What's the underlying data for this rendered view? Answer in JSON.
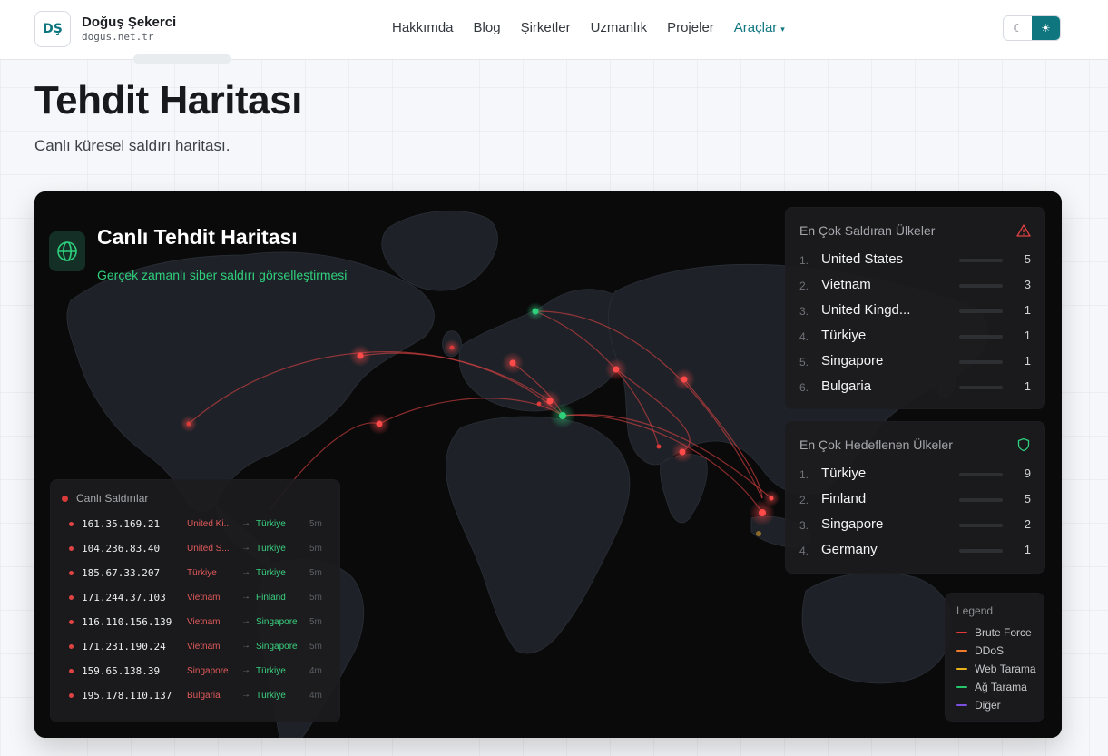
{
  "header": {
    "logo_text": "DŞ",
    "brand_name": "Doğuş Şekerci",
    "brand_url": "dogus.net.tr",
    "nav": [
      {
        "label": "Hakkımda"
      },
      {
        "label": "Blog"
      },
      {
        "label": "Şirketler"
      },
      {
        "label": "Uzmanlık"
      },
      {
        "label": "Projeler"
      },
      {
        "label": "Araçlar",
        "caret": "▾"
      }
    ],
    "theme": {
      "dark_icon": "☾",
      "light_icon": "☀",
      "active": "light"
    }
  },
  "page": {
    "title": "Tehdit Haritası",
    "subtitle": "Canlı küresel saldırı haritası."
  },
  "map": {
    "title": "Canlı Tehdit Haritası",
    "subtitle": "Gerçek zamanlı siber saldırı görselleştirmesi",
    "colors": {
      "attack": "#e04343",
      "target": "#2fcf7c",
      "accent": "#0f7680"
    }
  },
  "top_attackers": {
    "title": "En Çok Saldıran Ülkeler",
    "icon": "warning-triangle-icon",
    "items": [
      {
        "rank": "1.",
        "country": "United States",
        "count": "5"
      },
      {
        "rank": "2.",
        "country": "Vietnam",
        "count": "3"
      },
      {
        "rank": "3.",
        "country": "United Kingd...",
        "count": "1"
      },
      {
        "rank": "4.",
        "country": "Türkiye",
        "count": "1"
      },
      {
        "rank": "5.",
        "country": "Singapore",
        "count": "1"
      },
      {
        "rank": "6.",
        "country": "Bulgaria",
        "count": "1"
      }
    ]
  },
  "top_targets": {
    "title": "En Çok Hedeflenen Ülkeler",
    "icon": "shield-icon",
    "items": [
      {
        "rank": "1.",
        "country": "Türkiye",
        "count": "9"
      },
      {
        "rank": "2.",
        "country": "Finland",
        "count": "5"
      },
      {
        "rank": "3.",
        "country": "Singapore",
        "count": "2"
      },
      {
        "rank": "4.",
        "country": "Germany",
        "count": "1"
      }
    ]
  },
  "live_attacks": {
    "title": "Canlı Saldırılar",
    "rows": [
      {
        "ip": "161.35.169.21",
        "source": "United Ki...",
        "target": "Türkiye",
        "time": "5m"
      },
      {
        "ip": "104.236.83.40",
        "source": "United S...",
        "target": "Türkiye",
        "time": "5m"
      },
      {
        "ip": "185.67.33.207",
        "source": "Türkiye",
        "target": "Türkiye",
        "time": "5m"
      },
      {
        "ip": "171.244.37.103",
        "source": "Vietnam",
        "target": "Finland",
        "time": "5m"
      },
      {
        "ip": "116.110.156.139",
        "source": "Vietnam",
        "target": "Singapore",
        "time": "5m"
      },
      {
        "ip": "171.231.190.24",
        "source": "Vietnam",
        "target": "Singapore",
        "time": "5m"
      },
      {
        "ip": "159.65.138.39",
        "source": "Singapore",
        "target": "Türkiye",
        "time": "4m"
      },
      {
        "ip": "195.178.110.137",
        "source": "Bulgaria",
        "target": "Türkiye",
        "time": "4m"
      }
    ]
  },
  "legend": {
    "title": "Legend",
    "items": [
      {
        "label": "Brute Force",
        "color": "#e53935"
      },
      {
        "label": "DDoS",
        "color": "#f07b28"
      },
      {
        "label": "Web Tarama",
        "color": "#e8b21c"
      },
      {
        "label": "Ağ Tarama",
        "color": "#25c76a"
      },
      {
        "label": "Diğer",
        "color": "#7b4fe0"
      }
    ]
  }
}
